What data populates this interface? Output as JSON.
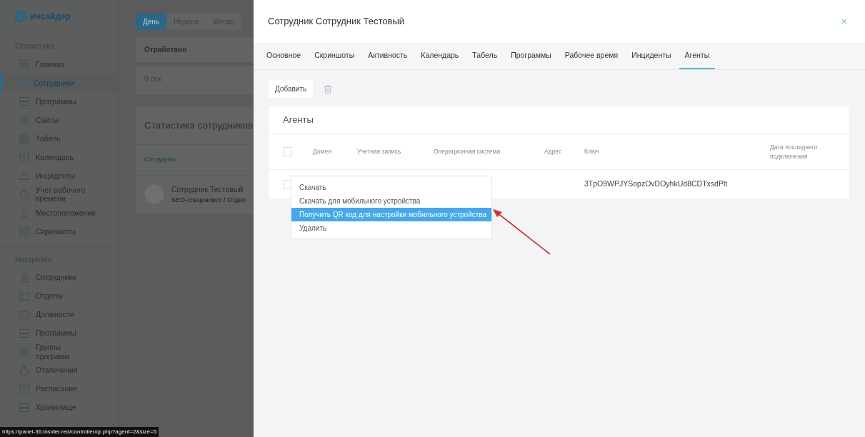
{
  "logo": {
    "text": "инсайдер"
  },
  "sidebar": {
    "sections": [
      {
        "title": "Статистика",
        "items": [
          {
            "label": "Главная",
            "selected": false
          },
          {
            "label": "Сотрудники",
            "selected": true
          },
          {
            "label": "Программы",
            "selected": false
          },
          {
            "label": "Сайты",
            "selected": false
          },
          {
            "label": "Табель",
            "selected": false
          },
          {
            "label": "Календарь",
            "selected": false
          },
          {
            "label": "Инциденты",
            "selected": false
          },
          {
            "label": "Учет рабочего времени",
            "selected": false
          },
          {
            "label": "Местоположение",
            "selected": false
          },
          {
            "label": "Скриншоты",
            "selected": false
          }
        ]
      },
      {
        "title": "Настройка",
        "items": [
          {
            "label": "Сотрудники",
            "selected": false
          },
          {
            "label": "Отделы",
            "selected": false
          },
          {
            "label": "Должности",
            "selected": false
          },
          {
            "label": "Программы",
            "selected": false
          },
          {
            "label": "Группы программ",
            "selected": false
          },
          {
            "label": "Отвлечения",
            "selected": false
          },
          {
            "label": "Расписание",
            "selected": false
          },
          {
            "label": "Хранилище",
            "selected": false
          }
        ]
      }
    ]
  },
  "period_tabs": [
    {
      "label": "День",
      "selected": true
    },
    {
      "label": "Неделя",
      "selected": false
    },
    {
      "label": "Месяц",
      "selected": false
    }
  ],
  "worked_card": {
    "title": "Отработано",
    "value": "0 сек"
  },
  "stats_card": {
    "title": "Статистика сотрудников",
    "sort_column": "Сотрудник ↓",
    "rows": [
      {
        "name": "Сотрудник Тестовый",
        "subtitle": "SEO-специалист / Отдел"
      }
    ]
  },
  "modal": {
    "title": "Сотрудник Сотрудник Тестовый",
    "close": "×",
    "tabs": [
      {
        "label": "Основное",
        "selected": false
      },
      {
        "label": "Скриншоты",
        "selected": false
      },
      {
        "label": "Активность",
        "selected": false
      },
      {
        "label": "Календарь",
        "selected": false
      },
      {
        "label": "Табель",
        "selected": false
      },
      {
        "label": "Программы",
        "selected": false
      },
      {
        "label": "Рабочее время",
        "selected": false
      },
      {
        "label": "Инциденты",
        "selected": false
      },
      {
        "label": "Агенты",
        "selected": true
      }
    ],
    "add_button": "Добавить",
    "agents_card": {
      "title": "Агенты",
      "select_all_checked": false,
      "columns": [
        "Домен",
        "Учетная запись",
        "Операционная система",
        "Адрес",
        "Ключ",
        "Дата последнего подключения"
      ],
      "rows": [
        {
          "checked": false,
          "key": "3TpO9WPJYSopzOvDOyhkUd8CDTxsdPlt"
        }
      ]
    },
    "context_menu": {
      "items": [
        {
          "label": "Скачать",
          "selected": false
        },
        {
          "label": "Скачать для мобильного устройства",
          "selected": false
        },
        {
          "label": "Получить QR код для настройки мобильного устройства",
          "selected": true
        },
        {
          "label": "Удалить",
          "selected": false
        }
      ]
    }
  },
  "status_bar": {
    "url": "https://panel-36.insider.red/controller/qr.php?agent=2&size=5"
  }
}
